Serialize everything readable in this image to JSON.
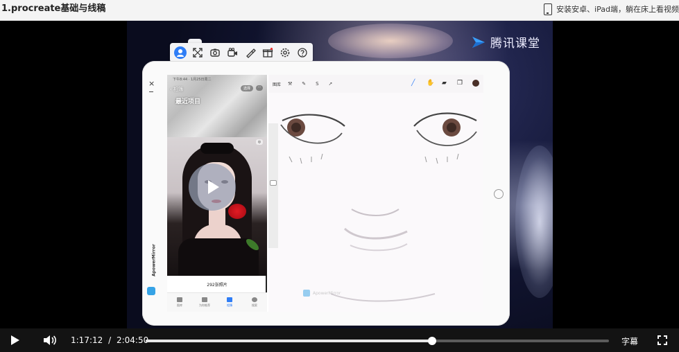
{
  "page": {
    "title": "1.procreate基础与线稿",
    "promo_text": "安装安卓、iPad端，躺在床上看视频"
  },
  "video": {
    "watermark": "腾讯课堂",
    "current_time": "1:17:12",
    "separator": "/",
    "duration": "2:04:50",
    "progress_fraction": 0.618,
    "subtitles_label": "字幕"
  },
  "mirror_toolbar": {
    "icons": [
      "user-icon",
      "expand-icon",
      "screenshot-icon",
      "record-icon",
      "brush-icon",
      "gift-icon",
      "settings-icon",
      "help-icon"
    ],
    "active_icon": "user-icon",
    "accent": "#2f7df6"
  },
  "mirror_side": {
    "close": "×",
    "brand": "ApowerMirror"
  },
  "photos_app": {
    "status": "下午8:44 · 1月25日周二",
    "back_label": "相簿",
    "select_label": "选择",
    "album_title": "最近项目",
    "count_label": "292张照片",
    "tabs": [
      {
        "label": "图库",
        "active": false
      },
      {
        "label": "为你推荐",
        "active": false
      },
      {
        "label": "相簿",
        "active": true
      },
      {
        "label": "搜索",
        "active": false
      }
    ]
  },
  "procreate": {
    "gallery_label": "图库",
    "color_swatch": "#4a2f28",
    "canvas_watermark": "ApowerMirror"
  }
}
